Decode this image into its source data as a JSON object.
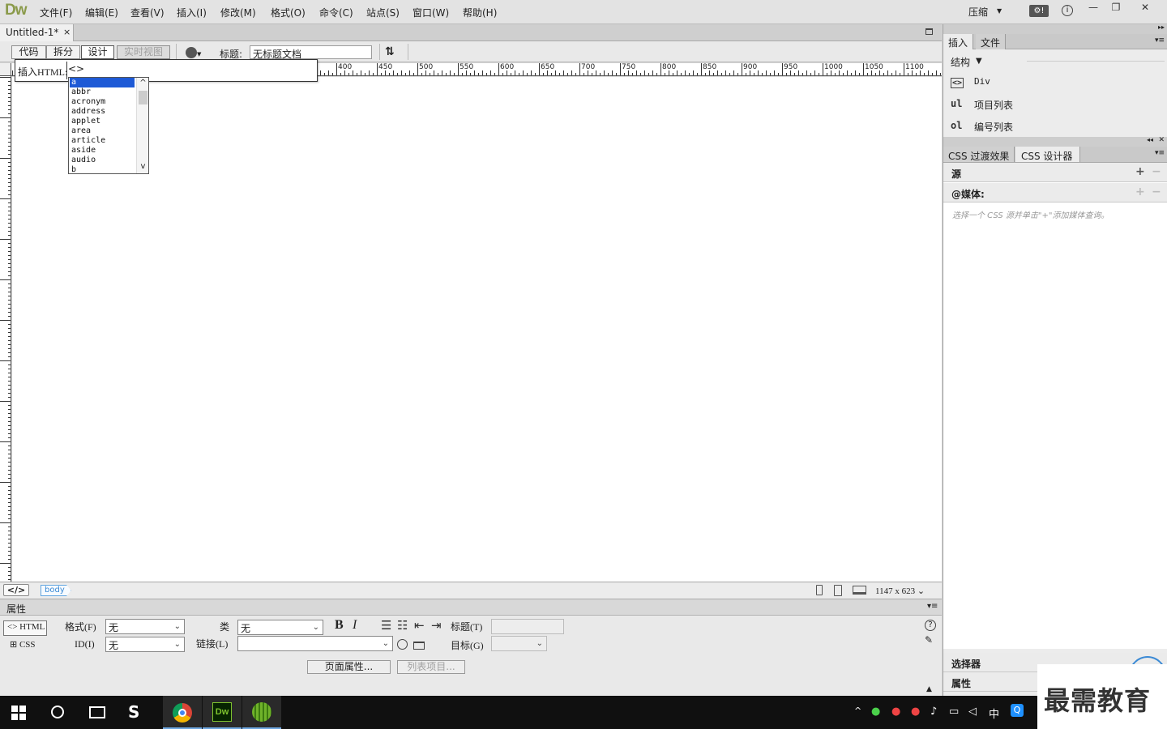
{
  "app": {
    "logo": "Dw"
  },
  "menu": {
    "items": [
      "文件(F)",
      "编辑(E)",
      "查看(V)",
      "插入(I)",
      "修改(M)",
      "格式(O)",
      "命令(C)",
      "站点(S)",
      "窗口(W)",
      "帮助(H)"
    ],
    "workspace": "压缩"
  },
  "document": {
    "tab_title": "Untitled-1*",
    "tab_close": "×"
  },
  "toolbar": {
    "code": "代码",
    "split": "拆分",
    "design": "设计",
    "live_view": "实时视图",
    "title_label": "标题:",
    "title_value": "无标题文档"
  },
  "ruler": {
    "top_labels": [
      "400",
      "450",
      "500",
      "550",
      "600",
      "650",
      "700",
      "750",
      "800",
      "850",
      "900",
      "950",
      "1000",
      "1050",
      "1100"
    ]
  },
  "insert_html": {
    "label": "插入HTML:",
    "value": "<>",
    "tags": [
      "a",
      "abbr",
      "acronym",
      "address",
      "applet",
      "area",
      "article",
      "aside",
      "audio",
      "b"
    ],
    "selected": "a"
  },
  "status": {
    "code_button": "</>",
    "body_tag": "body",
    "canvas_size": "1147 x 623"
  },
  "properties": {
    "title": "属性",
    "html_button": "HTML",
    "css_button": "CSS",
    "format_label": "格式(F)",
    "format_value": "无",
    "id_label": "ID(I)",
    "id_value": "无",
    "class_label": "类",
    "class_value": "无",
    "link_label": "链接(L)",
    "link_value": "",
    "bold": "B",
    "italic": "I",
    "heading_label": "标题(T)",
    "target_label": "目标(G)",
    "page_props": "页面属性...",
    "list_item": "列表项目..."
  },
  "right_panel": {
    "tabs_top": [
      "插入",
      "文件"
    ],
    "structure_label": "结构",
    "insert_items": [
      {
        "icon": "<>",
        "label": "Div"
      },
      {
        "icon": "ul",
        "label": "项目列表"
      },
      {
        "icon": "ol",
        "label": "编号列表"
      }
    ],
    "tabs_css": [
      "CSS 过渡效果",
      "CSS 设计器"
    ],
    "sources": "源",
    "media": "@媒体:",
    "media_hint": "选择一个 CSS 源并单击\"+\"添加媒体查询。",
    "selectors": "选择器",
    "props": "属性"
  },
  "watermark": {
    "text": "最需教育"
  },
  "taskbar": {
    "ime": "中"
  }
}
